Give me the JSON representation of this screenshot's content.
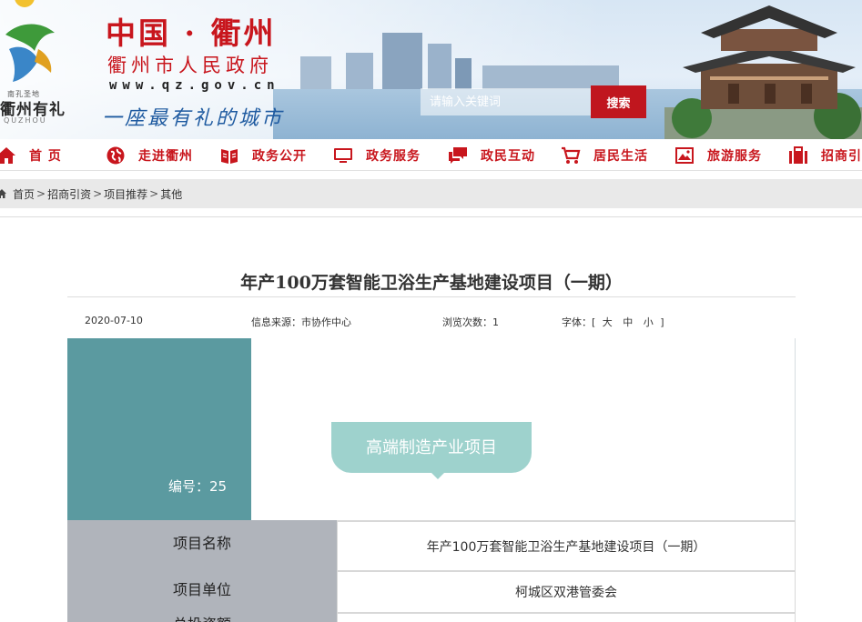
{
  "header": {
    "logo_small_text": "南孔圣地",
    "logo_text": "衢州有礼",
    "logo_en": "QUZHOU",
    "title": "中国 · 衢州",
    "subtitle": "衢州市人民政府",
    "url": "www.qz.gov.cn",
    "slogan": "一座最有礼的城市",
    "search": {
      "placeholder": "请输入关键词",
      "button_label": "搜索"
    }
  },
  "nav": {
    "items": [
      {
        "label": "首 页",
        "icon": "home-icon"
      },
      {
        "label": "走进衢州",
        "icon": "globe-icon"
      },
      {
        "label": "政务公开",
        "icon": "book-icon"
      },
      {
        "label": "政务服务",
        "icon": "monitor-icon"
      },
      {
        "label": "政民互动",
        "icon": "chat-icon"
      },
      {
        "label": "居民生活",
        "icon": "cart-icon"
      },
      {
        "label": "旅游服务",
        "icon": "picture-icon"
      },
      {
        "label": "招商引",
        "icon": "briefcase-icon"
      }
    ],
    "color": "#c8161d"
  },
  "breadcrumb": {
    "items": [
      "首页",
      "招商引资",
      "项目推荐",
      "其他"
    ],
    "separator": ">"
  },
  "article": {
    "title": "年产100万套智能卫浴生产基地建设项目（一期）",
    "date": "2020-07-10",
    "source_label": "信息来源：",
    "source": "市协作中心",
    "views_label": "浏览次数：",
    "views": "1",
    "font_label": "字体：",
    "font_open": "[",
    "font_large": "大",
    "font_medium": "中",
    "font_small": "小",
    "font_close": "]"
  },
  "hero": {
    "code": "编号：25",
    "category": "高端制造产业项目",
    "left_color": "#5b9aa0",
    "bubble_color": "#9ed2cd"
  },
  "info_rows": [
    {
      "key": "项目名称",
      "value": "年产100万套智能卫浴生产基地建设项目（一期）"
    },
    {
      "key": "项目单位",
      "value": "柯城区双港管委会"
    },
    {
      "key": "总投资额",
      "value": ""
    }
  ]
}
